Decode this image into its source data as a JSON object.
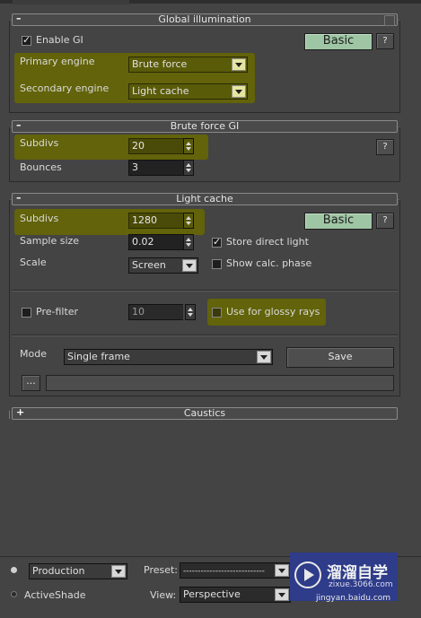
{
  "global_illumination": {
    "title": "Global illumination",
    "collapse_sign": "–",
    "enable_gi_label": "Enable GI",
    "enable_gi_checked": true,
    "mode_button": "Basic",
    "help_button": "?",
    "primary_engine_label": "Primary engine",
    "primary_engine_value": "Brute force",
    "secondary_engine_label": "Secondary engine",
    "secondary_engine_value": "Light cache"
  },
  "brute_force": {
    "title": "Brute force GI",
    "collapse_sign": "–",
    "subdivs_label": "Subdivs",
    "subdivs_value": "20",
    "bounces_label": "Bounces",
    "bounces_value": "3",
    "help_button": "?"
  },
  "light_cache": {
    "title": "Light cache",
    "collapse_sign": "–",
    "subdivs_label": "Subdivs",
    "subdivs_value": "1280",
    "sample_size_label": "Sample size",
    "sample_size_value": "0.02",
    "scale_label": "Scale",
    "scale_value": "Screen",
    "mode_button": "Basic",
    "help_button": "?",
    "store_direct_light_label": "Store direct light",
    "store_direct_light_checked": true,
    "show_calc_phase_label": "Show calc. phase",
    "show_calc_phase_checked": false,
    "prefilter_label": "Pre-filter",
    "prefilter_checked": false,
    "prefilter_value": "10",
    "use_glossy_label": "Use for glossy rays",
    "use_glossy_checked": false,
    "mode_label": "Mode",
    "mode_value": "Single frame",
    "save_button": "Save",
    "browse_button": "...",
    "file_path": ""
  },
  "caustics": {
    "title": "Caustics",
    "expand_sign": "+"
  },
  "bottom": {
    "production_label": "Production",
    "activeshade_label": "ActiveShade",
    "preset_label": "Preset:",
    "preset_value": "----------------------------",
    "view_label": "View:",
    "view_value": "Perspective"
  },
  "watermark": {
    "brand": "溜溜自学",
    "url": "zixue.3066.com",
    "credit": "jingyan.baidu.com"
  },
  "colors": {
    "highlight": "#62630a",
    "basic_button": "#9fc6a4",
    "panel_bg": "#444444"
  }
}
